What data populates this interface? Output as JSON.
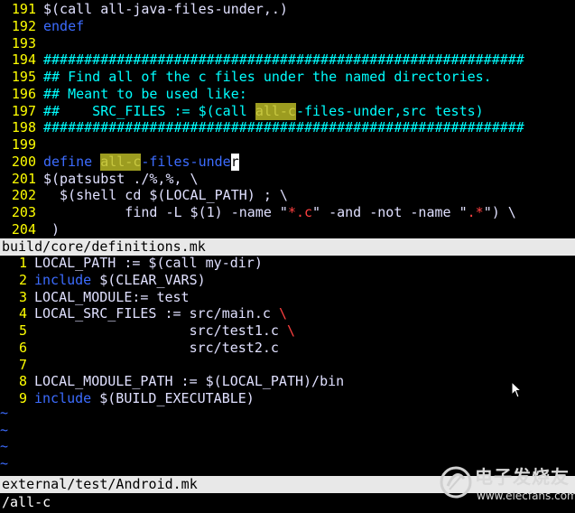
{
  "colors": {
    "line_number": "#ffff00",
    "keyword": "#3c6cff",
    "text": "#e0e0ff",
    "comment": "#00ffff",
    "string": "#ff4040",
    "highlight": "#9c9c20",
    "status_bar_bg": "#e8e8e8"
  },
  "top_pane": {
    "lines": [
      {
        "num": "191",
        "segments": [
          {
            "t": "$(call all-java-files-under,.)",
            "c": "text"
          }
        ]
      },
      {
        "num": "192",
        "segments": [
          {
            "t": "endef",
            "c": "keyword"
          }
        ]
      },
      {
        "num": "193",
        "segments": []
      },
      {
        "num": "194",
        "segments": [
          {
            "t": "###########################################################",
            "c": "comment"
          }
        ]
      },
      {
        "num": "195",
        "segments": [
          {
            "t": "## Find all of the c files under the named directories.",
            "c": "comment"
          }
        ]
      },
      {
        "num": "196",
        "segments": [
          {
            "t": "## Meant to be used like:",
            "c": "comment"
          }
        ]
      },
      {
        "num": "197",
        "segments": [
          {
            "t": "##    SRC_FILES := $(call ",
            "c": "comment"
          },
          {
            "t": "all-c",
            "c": "highlight"
          },
          {
            "t": "-files-under,src tests)",
            "c": "comment"
          }
        ]
      },
      {
        "num": "198",
        "segments": [
          {
            "t": "###########################################################",
            "c": "comment"
          }
        ]
      },
      {
        "num": "199",
        "segments": []
      },
      {
        "num": "200",
        "segments": [
          {
            "t": "define ",
            "c": "keyword"
          },
          {
            "t": "all-c",
            "c": "highlight"
          },
          {
            "t": "-files-unde",
            "c": "keyword"
          },
          {
            "t": "r",
            "c": "cursor"
          }
        ]
      },
      {
        "num": "201",
        "segments": [
          {
            "t": "$(patsubst ./%,%, \\",
            "c": "text"
          }
        ]
      },
      {
        "num": "202",
        "segments": [
          {
            "t": "  $(shell cd $(LOCAL_PATH) ; \\",
            "c": "text"
          }
        ]
      },
      {
        "num": "203",
        "segments": [
          {
            "t": "          find -L $(1) -name ",
            "c": "text"
          },
          {
            "t": "\"",
            "c": "text"
          },
          {
            "t": "*.c",
            "c": "string"
          },
          {
            "t": "\" -and -not -name \"",
            "c": "text"
          },
          {
            "t": ".*",
            "c": "string"
          },
          {
            "t": "\") \\",
            "c": "text"
          }
        ]
      },
      {
        "num": "204",
        "segments": [
          {
            "t": " )",
            "c": "text"
          }
        ]
      }
    ],
    "status": "build/core/definitions.mk"
  },
  "bottom_pane": {
    "lines": [
      {
        "num": "1",
        "segments": [
          {
            "t": "LOCAL_PATH := $(call my-dir)",
            "c": "text"
          }
        ]
      },
      {
        "num": "2",
        "segments": [
          {
            "t": "include",
            "c": "keyword"
          },
          {
            "t": " $(CLEAR_VARS)",
            "c": "text"
          }
        ]
      },
      {
        "num": "3",
        "segments": [
          {
            "t": "LOCAL_MODULE:= test",
            "c": "text"
          }
        ]
      },
      {
        "num": "4",
        "segments": [
          {
            "t": "LOCAL_SRC_FILES := src/main.c ",
            "c": "text"
          },
          {
            "t": "\\",
            "c": "string"
          }
        ]
      },
      {
        "num": "5",
        "segments": [
          {
            "t": "                   src/test1.c ",
            "c": "text"
          },
          {
            "t": "\\",
            "c": "string"
          }
        ]
      },
      {
        "num": "6",
        "segments": [
          {
            "t": "                   src/test2.c",
            "c": "text"
          }
        ]
      },
      {
        "num": "7",
        "segments": []
      },
      {
        "num": "8",
        "segments": [
          {
            "t": "LOCAL_MODULE_PATH := $(LOCAL_PATH)/bin",
            "c": "text"
          }
        ]
      },
      {
        "num": "9",
        "segments": [
          {
            "t": "include",
            "c": "keyword"
          },
          {
            "t": " $(BUILD_EXECUTABLE)",
            "c": "text"
          }
        ]
      }
    ],
    "tildes": [
      "~",
      "~",
      "~",
      "~"
    ],
    "status": "external/test/Android.mk"
  },
  "command_line": "/all-c",
  "watermark": {
    "brand": "电子发烧友",
    "url": "www.elecfans.com"
  }
}
